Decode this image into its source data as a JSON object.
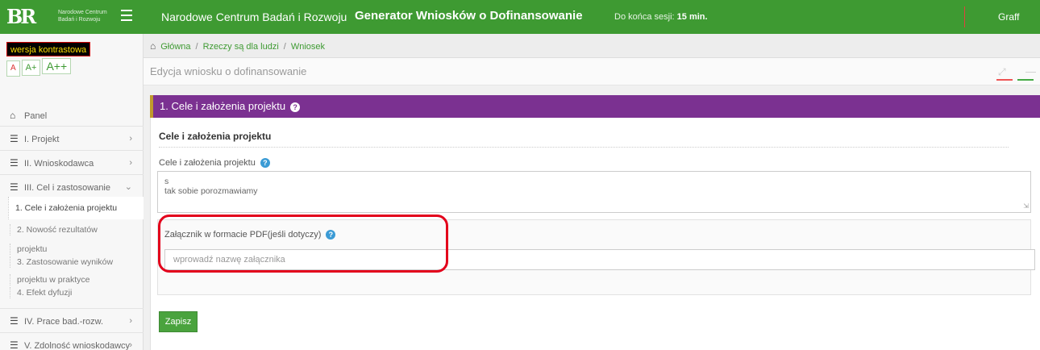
{
  "topbar": {
    "logo_text": "Narodowe Centrum Badań i Rozwoju",
    "title": "Narodowe Centrum Badań i Rozwoju",
    "subtitle": "Generator Wniosków o Dofinansowanie",
    "session_label": "Do końca sesji:",
    "session_value": "15 min.",
    "user": "Graff",
    "colors": {
      "bar": "#3e9a32",
      "separator": "#e0413f"
    },
    "icons": {
      "menu": "hamburger-icon"
    }
  },
  "sidebar": {
    "contrast": "wersja kontrastowa",
    "font_sizes": [
      "A",
      "A+",
      "A++"
    ],
    "items": [
      {
        "label": "Panel",
        "icon": "home-icon"
      },
      {
        "label": "I. Projekt",
        "icon": "list-icon"
      },
      {
        "label": "II. Wnioskodawca",
        "icon": "list-icon"
      },
      {
        "label": "III. Cel i zastosowanie",
        "icon": "list-icon"
      },
      {
        "label": "IV. Prace bad.-rozw.",
        "icon": "list-icon"
      },
      {
        "label": "V. Zdolność wnioskodawcy",
        "icon": "list-icon"
      }
    ],
    "subitems": [
      "1. Cele i założenia projektu",
      "2. Nowość rezultatów",
      "projektu",
      "3. Zastosowanie wyników",
      "projektu w praktyce",
      "4. Efekt dyfuzji"
    ]
  },
  "breadcrumb": [
    "Główna",
    "Rzeczy są dla ludzi",
    "Wniosek"
  ],
  "page_title": "Edycja wniosku o dofinansowanie",
  "panel": {
    "title": "1. Cele i założenia projektu",
    "color": "#7b3191",
    "section_title": "Cele i założenia projektu",
    "field1_label": "Cele i założenia projektu",
    "field1_value_line1": "s",
    "field1_value_line2": "tak sobie porozmawiamy",
    "attach_label": "Załącznik w formacie PDF(jeśli dotyczy)",
    "attach_placeholder": "wprowadź nazwę załącznika",
    "save": "Zapisz"
  }
}
